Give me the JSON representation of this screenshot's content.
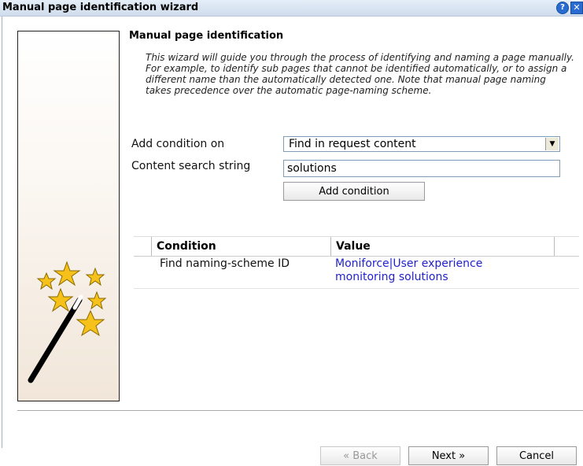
{
  "window": {
    "title": "Manual page identification wizard",
    "help_icon": "?",
    "close_icon": "✕"
  },
  "header": {
    "title": "Manual page identification"
  },
  "description": "This wizard will guide you through the process of identifying and naming a page manually. For example, to identify sub pages that cannot be identified automatically, or to assign a different name than the automatically detected one. Note that manual page naming takes precedence over the automatic page-naming scheme.",
  "form": {
    "add_condition_label": "Add condition on",
    "add_condition_value": "Find in request content",
    "content_search_label": "Content search string",
    "content_search_value": "solutions",
    "add_condition_button": "Add condition"
  },
  "table": {
    "columns": [
      "Condition",
      "Value"
    ],
    "rows": [
      {
        "condition": "Find naming-scheme ID",
        "value": "Moniforce|User experience monitoring solutions"
      }
    ]
  },
  "footer": {
    "back": "« Back",
    "next": "Next »",
    "cancel": "Cancel"
  },
  "colors": {
    "title_bar": "#cfdcec",
    "link_value": "#2222cc",
    "star": "#f6c21a"
  }
}
